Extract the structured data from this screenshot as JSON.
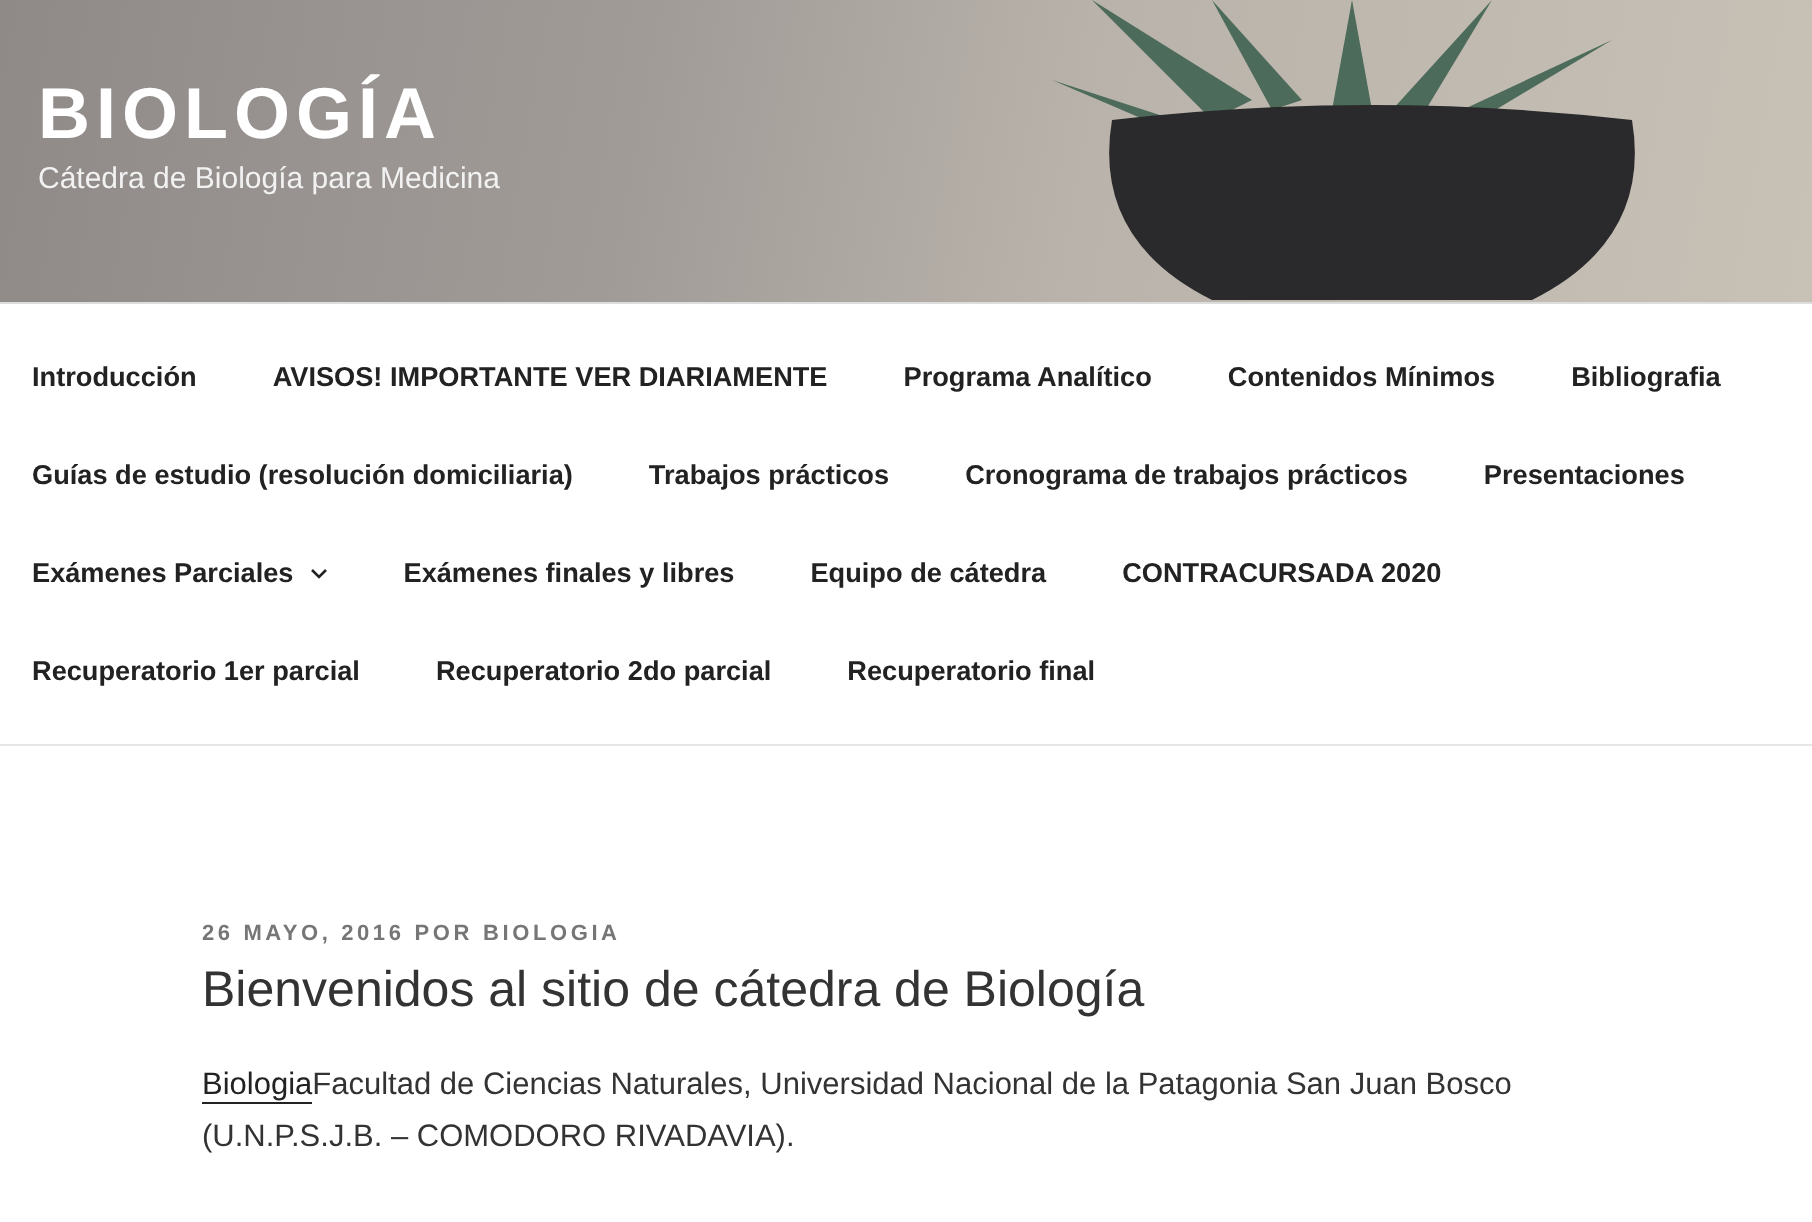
{
  "site": {
    "title": "BIOLOGÍA",
    "tagline": "Cátedra de Biología para Medicina"
  },
  "navigation": {
    "items": [
      {
        "label": "Introducción",
        "has_submenu": false
      },
      {
        "label": "AVISOS! IMPORTANTE VER DIARIAMENTE",
        "has_submenu": false
      },
      {
        "label": "Programa Analítico",
        "has_submenu": false
      },
      {
        "label": "Contenidos Mínimos",
        "has_submenu": false
      },
      {
        "label": "Bibliografia",
        "has_submenu": false
      },
      {
        "label": "Guías de estudio (resolución domiciliaria)",
        "has_submenu": false
      },
      {
        "label": "Trabajos prácticos",
        "has_submenu": false
      },
      {
        "label": "Cronograma de trabajos prácticos",
        "has_submenu": false
      },
      {
        "label": "Presentaciones",
        "has_submenu": false
      },
      {
        "label": "Exámenes Parciales",
        "has_submenu": true
      },
      {
        "label": "Exámenes finales y libres",
        "has_submenu": false
      },
      {
        "label": "Equipo de cátedra",
        "has_submenu": false
      },
      {
        "label": "CONTRACURSADA 2020",
        "has_submenu": false
      },
      {
        "label": "Recuperatorio 1er parcial",
        "has_submenu": false
      },
      {
        "label": "Recuperatorio 2do parcial",
        "has_submenu": false
      },
      {
        "label": "Recuperatorio final",
        "has_submenu": false
      }
    ]
  },
  "post": {
    "date": "26 MAYO, 2016",
    "by": "POR",
    "author": "BIOLOGIA",
    "title": "Bienvenidos al sitio de cátedra de Biología",
    "body_link": "Biologia",
    "body": "Facultad de Ciencias Naturales, Universidad Nacional de la Patagonia San Juan Bosco (U.N.P.S.J.B. – COMODORO RIVADAVIA)."
  }
}
